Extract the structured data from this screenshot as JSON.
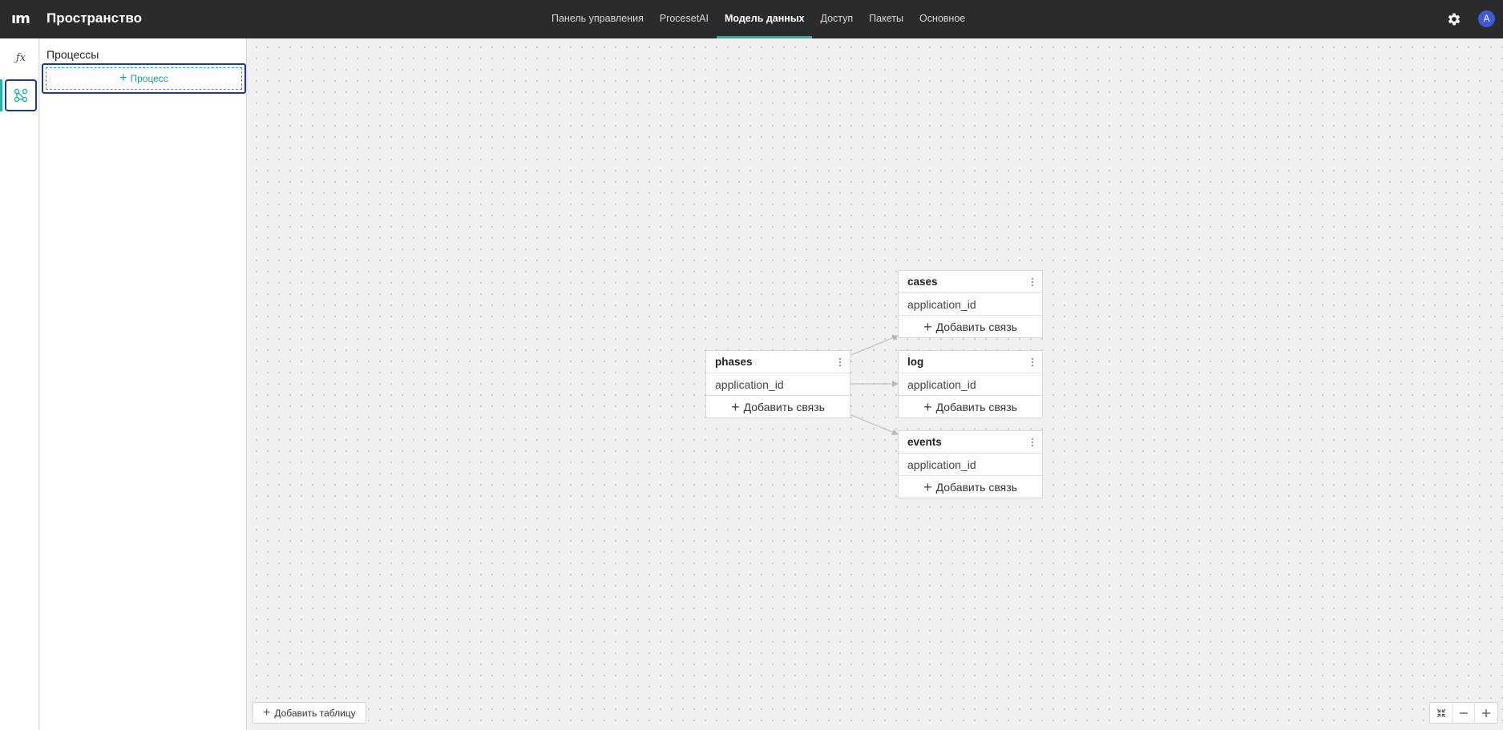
{
  "header": {
    "logo": "ım",
    "title": "Пространство",
    "tabs": [
      {
        "label": "Панель управления",
        "active": false
      },
      {
        "label": "ProcesetAI",
        "active": false
      },
      {
        "label": "Модель данных",
        "active": true
      },
      {
        "label": "Доступ",
        "active": false
      },
      {
        "label": "Пакеты",
        "active": false
      },
      {
        "label": "Основное",
        "active": false
      }
    ],
    "settings_icon": "gear-icon",
    "avatar_initial": "A"
  },
  "rail": {
    "items": [
      {
        "icon": "function-icon",
        "glyph": "ƒx"
      },
      {
        "icon": "data-model-icon",
        "active": true
      }
    ]
  },
  "processes": {
    "title": "Процессы",
    "add_label": "Процесс"
  },
  "canvas": {
    "tables": [
      {
        "name": "phases",
        "field": "application_id",
        "add_label": "Добавить связь"
      },
      {
        "name": "cases",
        "field": "application_id",
        "add_label": "Добавить связь"
      },
      {
        "name": "log",
        "field": "application_id",
        "add_label": "Добавить связь"
      },
      {
        "name": "events",
        "field": "application_id",
        "add_label": "Добавить связь"
      }
    ],
    "add_table_label": "Добавить таблицу",
    "zoom_controls": [
      "fit-screen-icon",
      "zoom-out-icon",
      "zoom-in-icon"
    ]
  },
  "colors": {
    "topbar": "#2b2b2b",
    "accent": "#1fb5ad",
    "focus": "#1c3a8f",
    "avatar": "#3d5bd9"
  }
}
